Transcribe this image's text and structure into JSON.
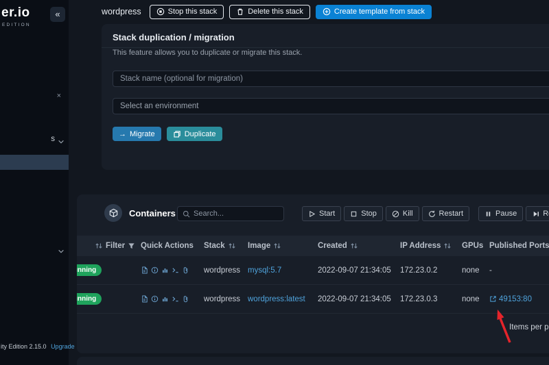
{
  "icons": {
    "collapse": "«",
    "close": "×",
    "arrow_right": "→"
  },
  "sidebar": {
    "logo_text": "er.io",
    "edition": "EDITION",
    "menu_item_partial": "s",
    "footer_version": "ity Edition 2.15.0",
    "footer_upgrade": "Upgrade"
  },
  "header": {
    "title": "wordpress",
    "stop_label": "Stop this stack",
    "delete_label": "Delete this stack",
    "create_label": "Create template from stack"
  },
  "duplication": {
    "title": "Stack duplication / migration",
    "description": "This feature allows you to duplicate or migrate this stack.",
    "name_placeholder": "Stack name (optional for migration)",
    "environment_placeholder": "Select an environment",
    "migrate_label": "Migrate",
    "duplicate_label": "Duplicate"
  },
  "containers": {
    "title": "Containers",
    "search_placeholder": "Search...",
    "actions": [
      "Start",
      "Stop",
      "Kill",
      "Restart",
      "Pause",
      "Resume"
    ],
    "pagination_label": "Items per page",
    "table": {
      "columns": [
        "Filter",
        "Quick Actions",
        "Stack",
        "Image",
        "Created",
        "IP Address",
        "GPUs",
        "Published Ports"
      ],
      "rows": [
        {
          "state": "running",
          "stack": "wordpress",
          "image": "mysql:5.7",
          "created": "2022-09-07 21:34:05",
          "ip_address": "172.23.0.2",
          "gpus": "none",
          "published_ports": "-"
        },
        {
          "state": "running",
          "stack": "wordpress",
          "image": "wordpress:latest",
          "created": "2022-09-07 21:34:05",
          "ip_address": "172.23.0.3",
          "gpus": "none",
          "published_ports": "49153:80"
        }
      ]
    }
  },
  "colors": {
    "accent_blue": "#0a82d4",
    "teal": "#2a8d9b",
    "green": "#1fa35c",
    "link": "#4fa3dc",
    "arrow_red": "#e5242b"
  }
}
